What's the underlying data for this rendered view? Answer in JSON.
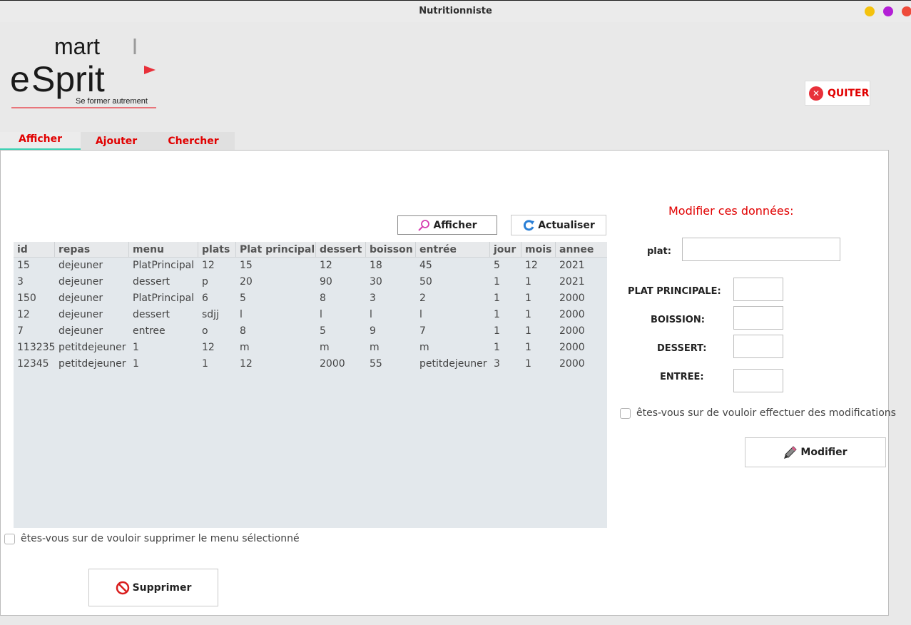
{
  "window": {
    "title": "Nutritionniste"
  },
  "logo": {
    "word_left": "e",
    "word_top": "mart",
    "word_main": "Sprit",
    "tagline": "Se former autrement",
    "accent": "#e8303a"
  },
  "header": {
    "quit_label": "QUITER"
  },
  "tabs": [
    {
      "label": "Afficher",
      "active": true
    },
    {
      "label": "Ajouter",
      "active": false
    },
    {
      "label": "Chercher",
      "active": false
    }
  ],
  "toolbar": {
    "afficher_label": "Afficher",
    "actualiser_label": "Actualiser"
  },
  "table": {
    "columns": [
      "id",
      "repas",
      "menu",
      "plats",
      "Plat principal",
      "dessert",
      "boisson",
      "entrée",
      "jour",
      "mois",
      "annee"
    ],
    "rows": [
      [
        "15",
        "dejeuner",
        "PlatPrincipal",
        "12",
        "15",
        "12",
        "18",
        "45",
        "5",
        "12",
        "2021"
      ],
      [
        "3",
        "dejeuner",
        "dessert",
        "p",
        "20",
        "90",
        "30",
        "50",
        "1",
        "1",
        "2021"
      ],
      [
        "150",
        "dejeuner",
        "PlatPrincipal",
        "6",
        "5",
        "8",
        "3",
        "2",
        "1",
        "1",
        "2000"
      ],
      [
        "12",
        "dejeuner",
        "dessert",
        "sdjj",
        "l",
        "l",
        "l",
        "l",
        "1",
        "1",
        "2000"
      ],
      [
        "7",
        "dejeuner",
        "entree",
        "o",
        "8",
        "5",
        "9",
        "7",
        "1",
        "1",
        "2000"
      ],
      [
        "113235",
        "petitdejeuner",
        "1",
        "12",
        "m",
        "m",
        "m",
        "m",
        "1",
        "1",
        "2000"
      ],
      [
        "12345",
        "petitdejeuner",
        "1",
        "1",
        "12",
        "2000",
        "55",
        "petitdejeuner",
        "3",
        "1",
        "2000"
      ]
    ]
  },
  "delete": {
    "confirm_label": "êtes-vous sur de vouloir supprimer le menu sélectionné",
    "button_label": "Supprimer"
  },
  "modify": {
    "title": "Modifier ces données:",
    "plat_label": "plat:",
    "plat_principale_label": "PLAT PRINCIPALE:",
    "boisson_label": "BOISSION:",
    "dessert_label": "DESSERT:",
    "entree_label": "ENTREE:",
    "confirm_label": "êtes-vous sur de vouloir effectuer des modifications",
    "button_label": "Modifier"
  },
  "colors": {
    "accent": "#e10000",
    "tab_underline": "#3bd2b4"
  }
}
